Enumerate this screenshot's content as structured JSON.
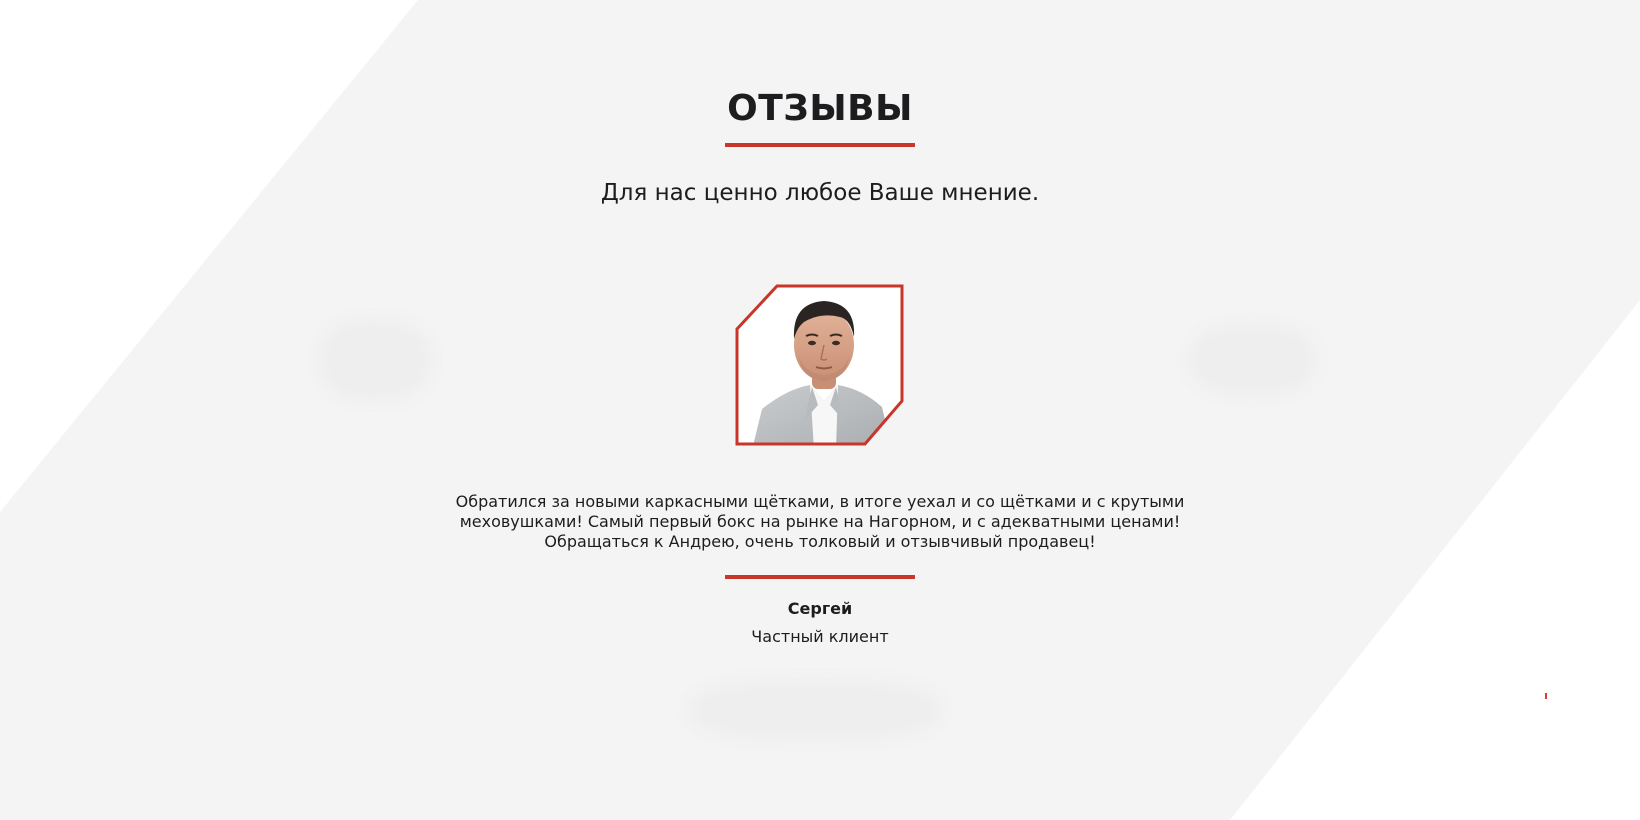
{
  "section": {
    "title": "ОТЗЫВЫ",
    "subtitle": "Для нас ценно любое Ваше мнение."
  },
  "review": {
    "text": "Обратился за новыми каркасными щётками, в итоге уехал и со щётками и с крутыми меховушками! Самый первый бокс на рынке на Нагорном, и с адекватными ценами! Обращаться к Андрею, очень толковый и отзывчивый продавец!",
    "author_name": "Сергей",
    "author_role": "Частный клиент",
    "avatar_icon": "person-photo"
  },
  "colors": {
    "accent": "#c8362a",
    "background_band": "#f4f4f4",
    "text": "#1d1d1f"
  }
}
